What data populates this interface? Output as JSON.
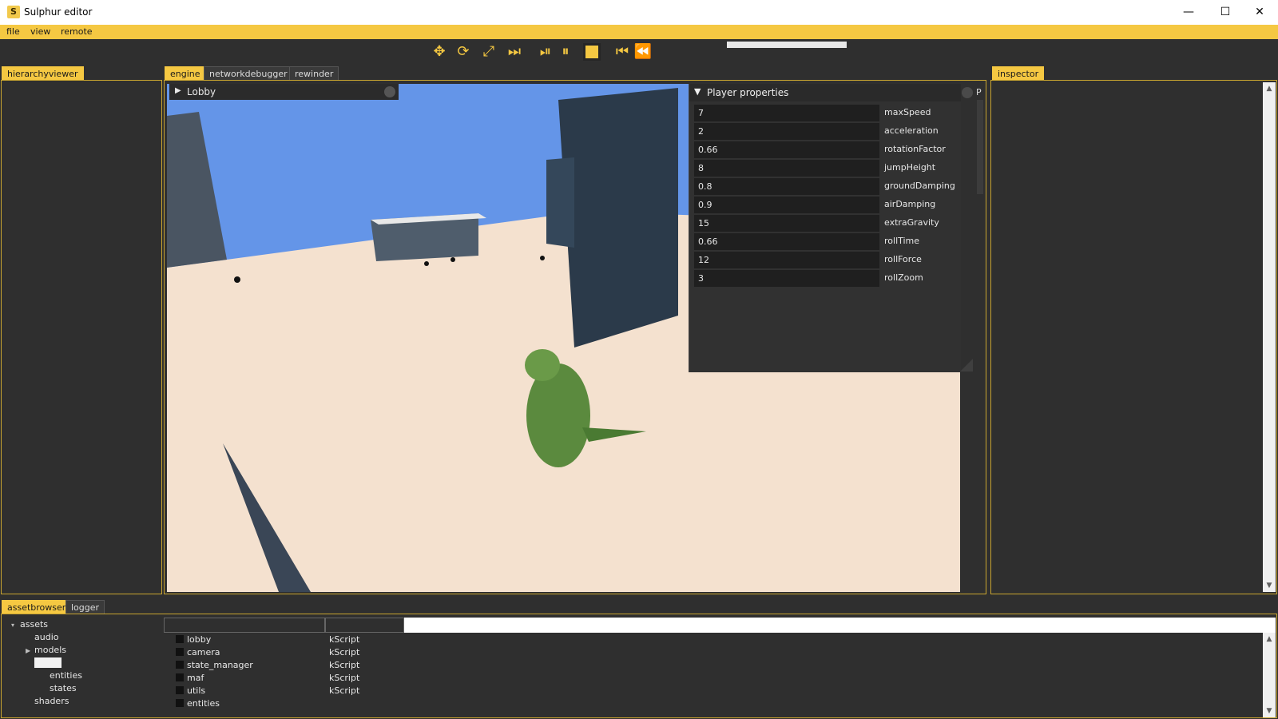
{
  "window": {
    "title": "Sulphur editor",
    "icon_letter": "S",
    "minimize_glyph": "—",
    "maximize_glyph": "☐",
    "close_glyph": "✕"
  },
  "menu": [
    "file",
    "view",
    "remote"
  ],
  "toolbar": {
    "icons": [
      "move-icon",
      "rotate-icon",
      "scale-icon",
      "fast-forward-icon",
      "step-forward-icon",
      "pause-icon",
      "stop-icon",
      "step-back-icon",
      "rewind-icon"
    ]
  },
  "left_panel": {
    "tab": "hierarchyviewer"
  },
  "center_tabs": [
    "engine",
    "networkdebugger",
    "rewinder"
  ],
  "right_panel": {
    "tab": "inspector"
  },
  "viewport": {
    "scene_label": "Lobby",
    "colors": {
      "sky": "#6495e8",
      "floor": "#f2dcc8",
      "wall": "#2b3a4a",
      "character": "#5b8a3e"
    }
  },
  "player_properties": {
    "title": "Player properties",
    "side_label": "P",
    "rows": [
      {
        "value": "7",
        "name": "maxSpeed"
      },
      {
        "value": "2",
        "name": "acceleration"
      },
      {
        "value": "0.66",
        "name": "rotationFactor"
      },
      {
        "value": "8",
        "name": "jumpHeight"
      },
      {
        "value": "0.8",
        "name": "groundDamping"
      },
      {
        "value": "0.9",
        "name": "airDamping"
      },
      {
        "value": "15",
        "name": "extraGravity"
      },
      {
        "value": "0.66",
        "name": "rollTime"
      },
      {
        "value": "12",
        "name": "rollForce"
      },
      {
        "value": "3",
        "name": "rollZoom"
      }
    ]
  },
  "bottom_tabs": [
    "assetbrowser",
    "logger"
  ],
  "asset_tree": [
    "assets",
    "audio",
    "models",
    "entities",
    "states",
    "shaders"
  ],
  "files": [
    {
      "name": "lobby",
      "type": "kScript"
    },
    {
      "name": "camera",
      "type": "kScript"
    },
    {
      "name": "state_manager",
      "type": "kScript"
    },
    {
      "name": "maf",
      "type": "kScript"
    },
    {
      "name": "utils",
      "type": "kScript"
    },
    {
      "name": "entities",
      "type": ""
    }
  ],
  "colors": {
    "accent": "#f5c842",
    "background": "#2f2f2f",
    "panel_border": "#c9a530"
  }
}
